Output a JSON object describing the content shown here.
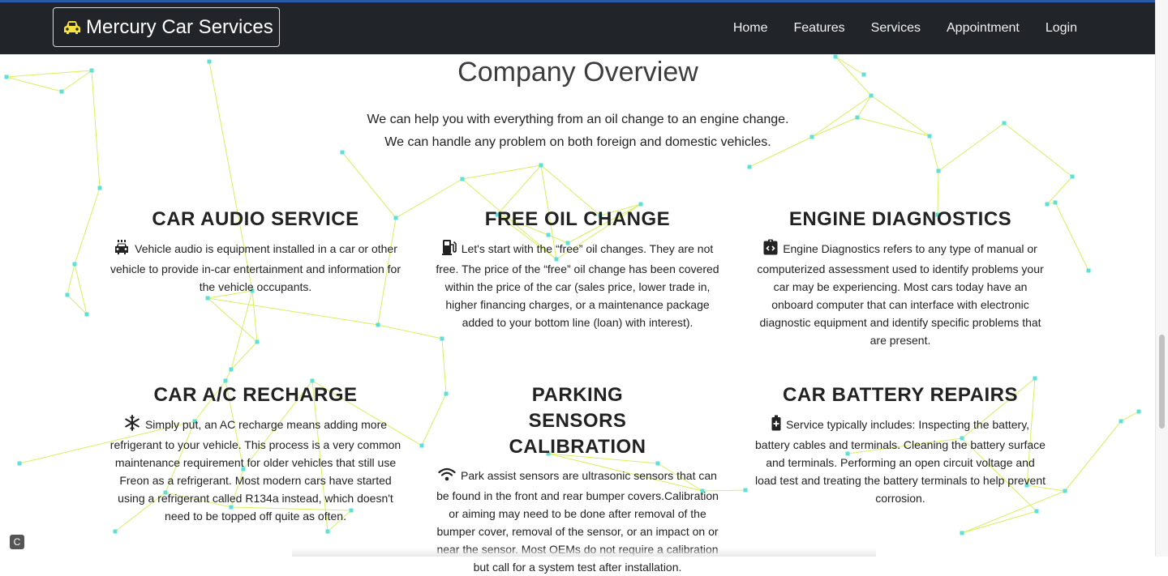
{
  "colors": {
    "navbar": "#212529",
    "accent_car": "#f6e23c",
    "network_line": "#d8f060",
    "network_node": "#5ee0d8"
  },
  "brand": {
    "name": "Mercury Car Services",
    "icon": "car-icon"
  },
  "nav": [
    "Home",
    "Features",
    "Services",
    "Appointment",
    "Login"
  ],
  "overview": {
    "title": "Company Overview",
    "line1": "We can help you with everything from an oil change to an engine change.",
    "line2": "We can handle any problem on both foreign and domestic vehicles."
  },
  "services": [
    {
      "title": "CAR AUDIO SERVICE",
      "icon": "car-audio-icon",
      "text": "Vehicle audio is equipment installed in a car or other vehicle to provide in-car entertainment and information for the vehicle occupants."
    },
    {
      "title": "FREE OIL CHANGE",
      "icon": "gas-pump-icon",
      "text": "Let's start with the “free” oil changes. They are not free. The price of the “free” oil change has been covered within the price of the car (sales price, lower trade in, higher financing charges, or a maintenance package added to your bottom line (loan) with interest)."
    },
    {
      "title": "ENGINE DIAGNOSTICS",
      "icon": "code-clipboard-icon",
      "text": "Engine Diagnostics refers to any type of manual or computerized assessment used to identify problems your car may be experiencing. Most cars today have an onboard computer that can interface with electronic diagnostic equipment and identify specific problems that are present."
    },
    {
      "title": "CAR A/C RECHARGE",
      "icon": "snowflake-icon",
      "text": "Simply put, an AC recharge means adding more refrigerant to your vehicle. This process is a very common maintenance requirement for older vehicles that still use Freon as a refrigerant. Most modern cars have started using a refrigerant called R134a instead, which doesn't need to be topped off quite as often."
    },
    {
      "title": "PARKING SENSORS CALIBRATION",
      "icon": "wifi-icon",
      "text": "Park assist sensors are ultrasonic sensors that can be found in the front and rear bumper covers.Calibration or aiming may need to be done after removal of the bumper cover, removal of the sensor, or an impact on or near the sensor. Most OEMs do not require a calibration but call for a system test after installation."
    },
    {
      "title": "CAR BATTERY REPAIRS",
      "icon": "battery-icon",
      "text": "Service typically includes: Inspecting the battery, battery cables and terminals. Cleaning the battery surface and terminals. Performing an open circuit voltage and load test and treating the battery terminals to help prevent corrosion."
    }
  ]
}
